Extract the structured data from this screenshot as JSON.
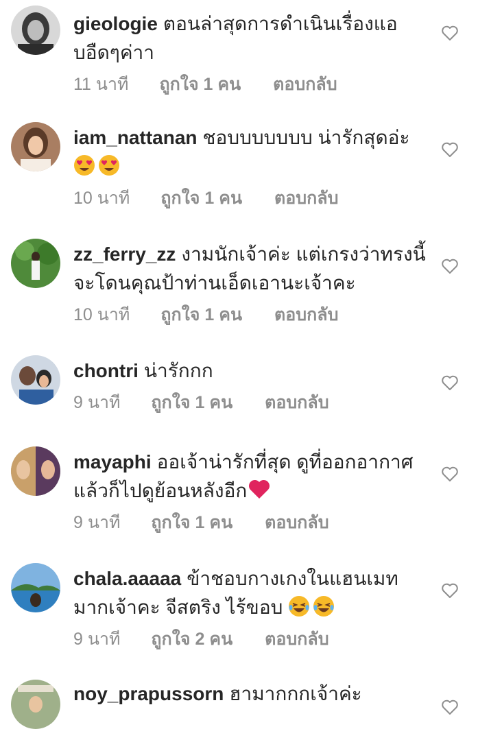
{
  "comments": [
    {
      "username": "gieologie",
      "text": "ตอนล่าสุดการดำเนินเรื่องแอบอืดๆค่าา",
      "time": "11 นาที",
      "likes": "ถูกใจ 1 คน",
      "reply": "ตอบกลับ",
      "emojis": []
    },
    {
      "username": "iam_nattanan",
      "text": "ชอบบบบบบบ น่ารักสุดอ่ะ",
      "time": "10 นาที",
      "likes": "ถูกใจ 1 คน",
      "reply": "ตอบกลับ",
      "emojis": [
        "heart-eyes",
        "heart-eyes"
      ]
    },
    {
      "username": "zz_ferry_zz",
      "text": "งามนักเจ้าค่ะ แต่เกรงว่าทรงนี้จะโดนคุณป้าท่านเอ็ดเอานะเจ้าคะ",
      "time": "10 นาที",
      "likes": "ถูกใจ 1 คน",
      "reply": "ตอบกลับ",
      "emojis": []
    },
    {
      "username": "chontri",
      "text": "น่ารักกก",
      "time": "9 นาที",
      "likes": "ถูกใจ 1 คน",
      "reply": "ตอบกลับ",
      "emojis": []
    },
    {
      "username": "mayaphi",
      "text": "ออเจ้าน่ารักที่สุด ดูที่ออกอากาศแล้วก็ไปดูย้อนหลังอีก",
      "time": "9 นาที",
      "likes": "ถูกใจ 1 คน",
      "reply": "ตอบกลับ",
      "emojis": [
        "red-heart"
      ]
    },
    {
      "username": "chala.aaaaa",
      "text": "ข้าชอบกางเกงในแฮนเมทมากเจ้าคะ จีสตริง ไร้ขอบ",
      "time": "9 นาที",
      "likes": "ถูกใจ 2 คน",
      "reply": "ตอบกลับ",
      "emojis": [
        "laughing",
        "laughing"
      ]
    },
    {
      "username": "noy_prapussorn",
      "text": "ฮามากกกเจ้าค่ะ",
      "time": "",
      "likes": "",
      "reply": "",
      "emojis": []
    }
  ],
  "colors": {
    "text": "#262626",
    "meta": "#8e8e8e",
    "heart_outline": "#8e8e8e",
    "emoji_red": "#e0245e"
  },
  "icons": [
    "heart-outline-icon",
    "heart-eyes-emoji",
    "red-heart-emoji",
    "laughing-emoji"
  ]
}
